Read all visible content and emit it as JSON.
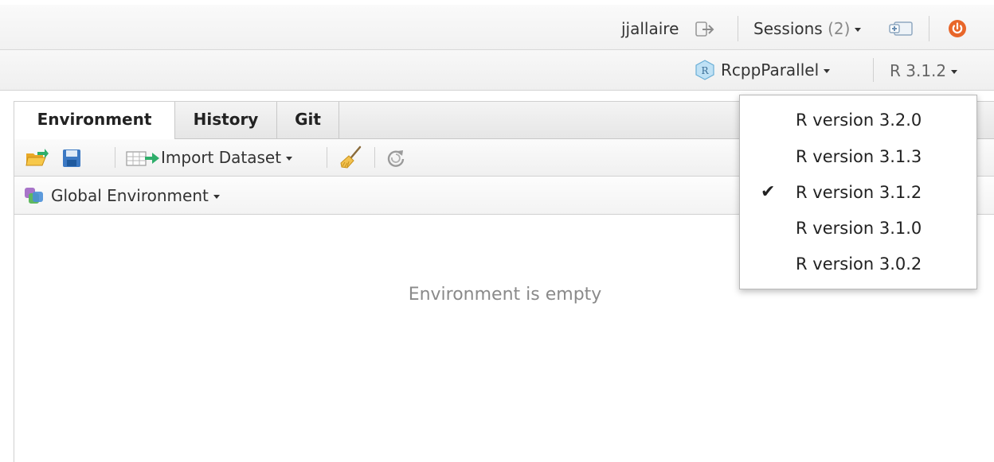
{
  "topbar": {
    "username": "jjallaire",
    "sessions_label": "Sessions",
    "sessions_count": "(2)",
    "signout_icon": "signout-icon",
    "new_session_icon": "new-session-icon",
    "quit_icon": "power-icon"
  },
  "projbar": {
    "project_name": "RcppParallel",
    "r_version": "R 3.1.2"
  },
  "tabs": [
    {
      "label": "Environment",
      "active": true
    },
    {
      "label": "History",
      "active": false
    },
    {
      "label": "Git",
      "active": false
    }
  ],
  "toolbar": {
    "import_label": "Import Dataset"
  },
  "env": {
    "scope_label": "Global Environment",
    "empty_message": "Environment is empty"
  },
  "r_version_menu": {
    "items": [
      {
        "label": "R version 3.2.0",
        "checked": false
      },
      {
        "label": "R version 3.1.3",
        "checked": false
      },
      {
        "label": "R version 3.1.2",
        "checked": true
      },
      {
        "label": "R version 3.1.0",
        "checked": false
      },
      {
        "label": "R version 3.0.2",
        "checked": false
      }
    ],
    "check_glyph": "✔"
  },
  "colors": {
    "power": "#e8662a",
    "folder": "#f2b632",
    "save": "#3b78c3",
    "arrow": "#2fae6b"
  }
}
